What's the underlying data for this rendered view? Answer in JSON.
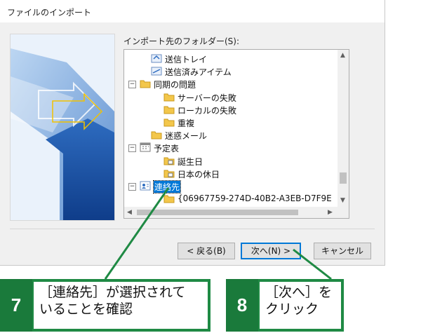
{
  "dialog": {
    "title": "ファイルのインポート",
    "folder_label": "インポート先のフォルダー(S):",
    "tree": [
      {
        "label": "送信トレイ",
        "icon": "outbox-icon",
        "expander": ""
      },
      {
        "label": "送信済みアイテム",
        "icon": "sent-items-icon",
        "expander": ""
      },
      {
        "label": "同期の問題",
        "icon": "folder-icon",
        "expander": "−"
      },
      {
        "label": "サーバーの失敗",
        "icon": "folder-icon",
        "expander": ""
      },
      {
        "label": "ローカルの失敗",
        "icon": "folder-icon",
        "expander": ""
      },
      {
        "label": "重複",
        "icon": "folder-icon",
        "expander": ""
      },
      {
        "label": "迷惑メール",
        "icon": "folder-icon",
        "expander": ""
      },
      {
        "label": "予定表",
        "icon": "calendar-icon",
        "expander": "−"
      },
      {
        "label": "誕生日",
        "icon": "calendar-folder-icon",
        "expander": ""
      },
      {
        "label": "日本の休日",
        "icon": "calendar-folder-icon",
        "expander": ""
      },
      {
        "label": "連絡先",
        "icon": "contacts-icon",
        "expander": "−",
        "selected": true
      },
      {
        "label": "{06967759-274D-40B2-A3EB-D7F9E",
        "icon": "folder-icon",
        "expander": ""
      }
    ],
    "buttons": {
      "back": "< 戻る(B)",
      "next": "次へ(N) >",
      "cancel": "キャンセル"
    }
  },
  "callouts": {
    "step7": {
      "num": "7",
      "text_line1": "［連絡先］が選択されて",
      "text_line2": "いることを確認"
    },
    "step8": {
      "num": "8",
      "text_line1": "［次へ］を",
      "text_line2": "クリック"
    }
  },
  "colors": {
    "accent_green": "#1f8a44",
    "selection_blue": "#0078d7"
  }
}
